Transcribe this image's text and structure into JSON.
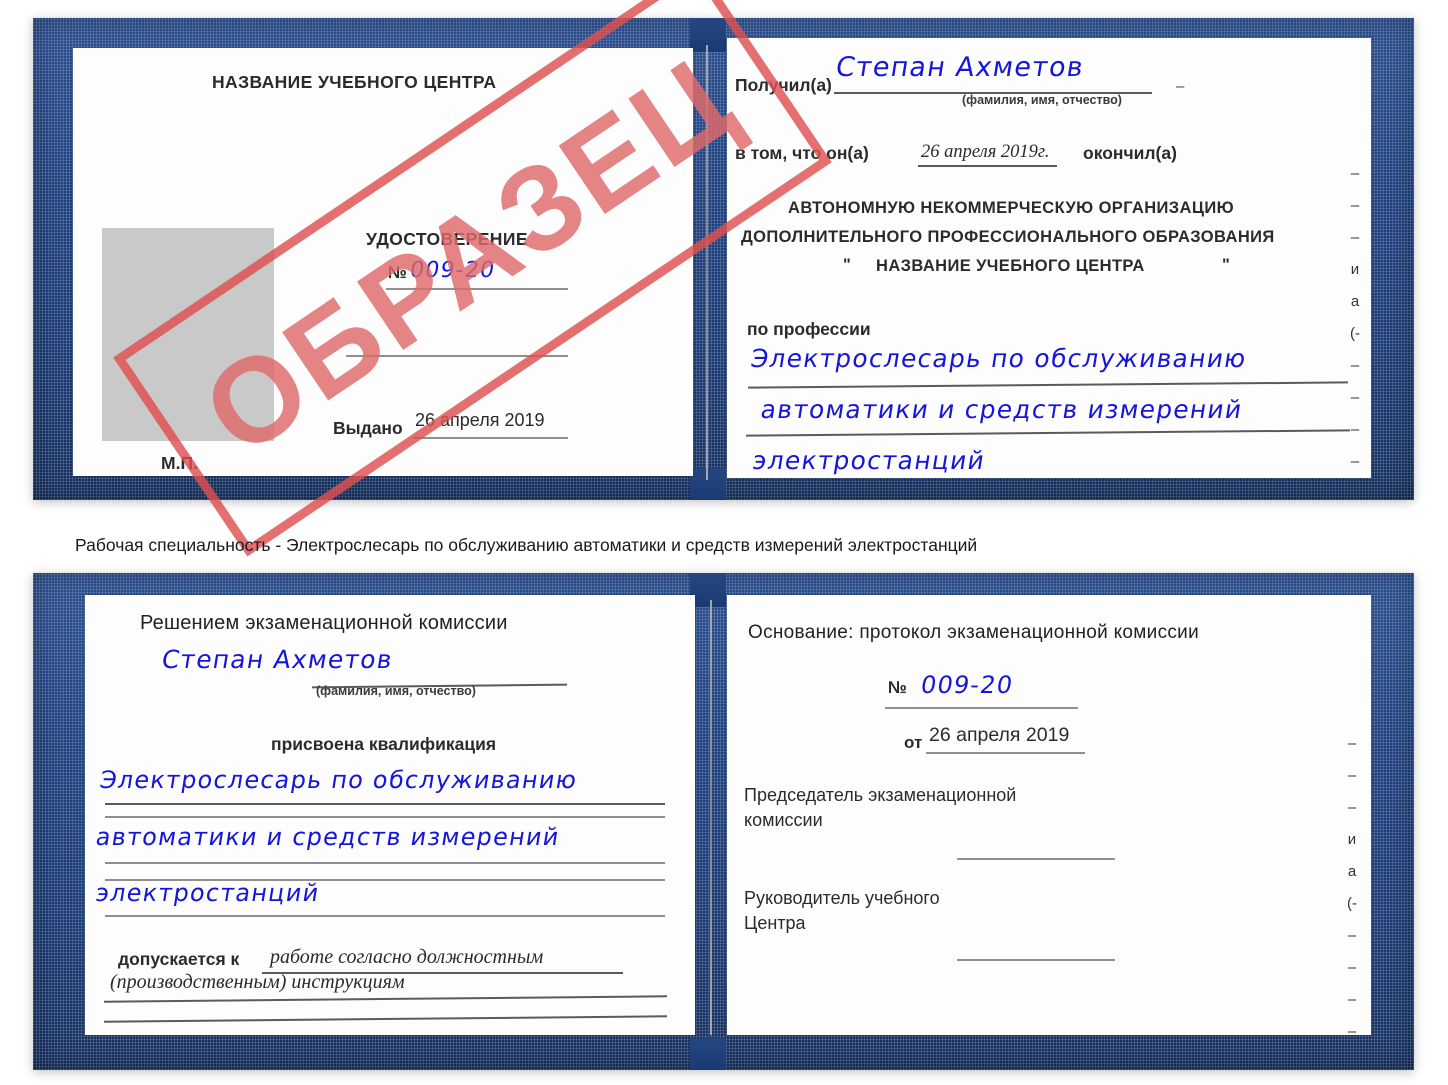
{
  "document": {
    "type": "Удостоверение",
    "stamp_label": "ОБРАЗЕЦ",
    "stamp_color": "#df5050",
    "cover_color": "#1f4180",
    "handwriting_color": "#1616d8"
  },
  "certificate_1": {
    "left_page": {
      "center_name": "НАЗВАНИЕ УЧЕБНОГО ЦЕНТРА",
      "title": "УДОСТОВЕРЕНИЕ",
      "number_label": "№",
      "number_value": "009-20",
      "issued_label": "Выдано",
      "issued_value": "26 апреля 2019",
      "seal_label": "М.П."
    },
    "right_page": {
      "received_label": "Получил(а)",
      "received_value": "Степан Ахметов",
      "received_hint": "(фамилия, имя, отчество)",
      "in_that_label": "в том, что он(а)",
      "in_that_value": "26 апреля 2019г.",
      "finished_label": "окончил(а)",
      "org_line1": "АВТОНОМНУЮ НЕКОММЕРЧЕСКУЮ ОРГАНИЗАЦИЮ",
      "org_line2": "ДОПОЛНИТЕЛЬНОГО ПРОФЕССИОНАЛЬНОГО ОБРАЗОВАНИЯ",
      "org_quote_open": "\"",
      "org_line3": "НАЗВАНИЕ УЧЕБНОГО ЦЕНТРА",
      "org_quote_close": "\"",
      "profession_label": "по профессии",
      "profession_line1": "Электрослесарь по обслуживанию",
      "profession_line2": "автоматики и средств измерений",
      "profession_line3": "электростанций",
      "edge_marks": [
        "–",
        "–",
        "–",
        "и",
        "а",
        "(-",
        "–",
        "–",
        "–",
        "–"
      ]
    }
  },
  "caption": {
    "text": "Рабочая специальность - Электрослесарь по обслуживанию автоматики и средств измерений электростанций"
  },
  "certificate_2": {
    "left_page": {
      "heading": "Решением экзаменационной комиссии",
      "name_value": "Степан Ахметов",
      "name_hint": "(фамилия, имя, отчество)",
      "qualification_label": "присвоена квалификация",
      "qualification_line1": "Электрослесарь по обслуживанию",
      "qualification_line2": "автоматики и средств измерений",
      "qualification_line3": "электростанций",
      "allowed_label": "допускается к",
      "allowed_value_line1": "работе согласно должностным",
      "allowed_value_line2": "(производственным) инструкциям"
    },
    "right_page": {
      "basis_label": "Основание: протокол экзаменационной комиссии",
      "number_label": "№",
      "number_value": "009-20",
      "date_label": "от",
      "date_value": "26 апреля 2019",
      "chairman_line1": "Председатель экзаменационной",
      "chairman_line2": "комиссии",
      "head_line1": "Руководитель учебного",
      "head_line2": "Центра",
      "edge_marks": [
        "–",
        "–",
        "–",
        "и",
        "а",
        "(-",
        "–",
        "–",
        "–",
        "–"
      ]
    }
  }
}
